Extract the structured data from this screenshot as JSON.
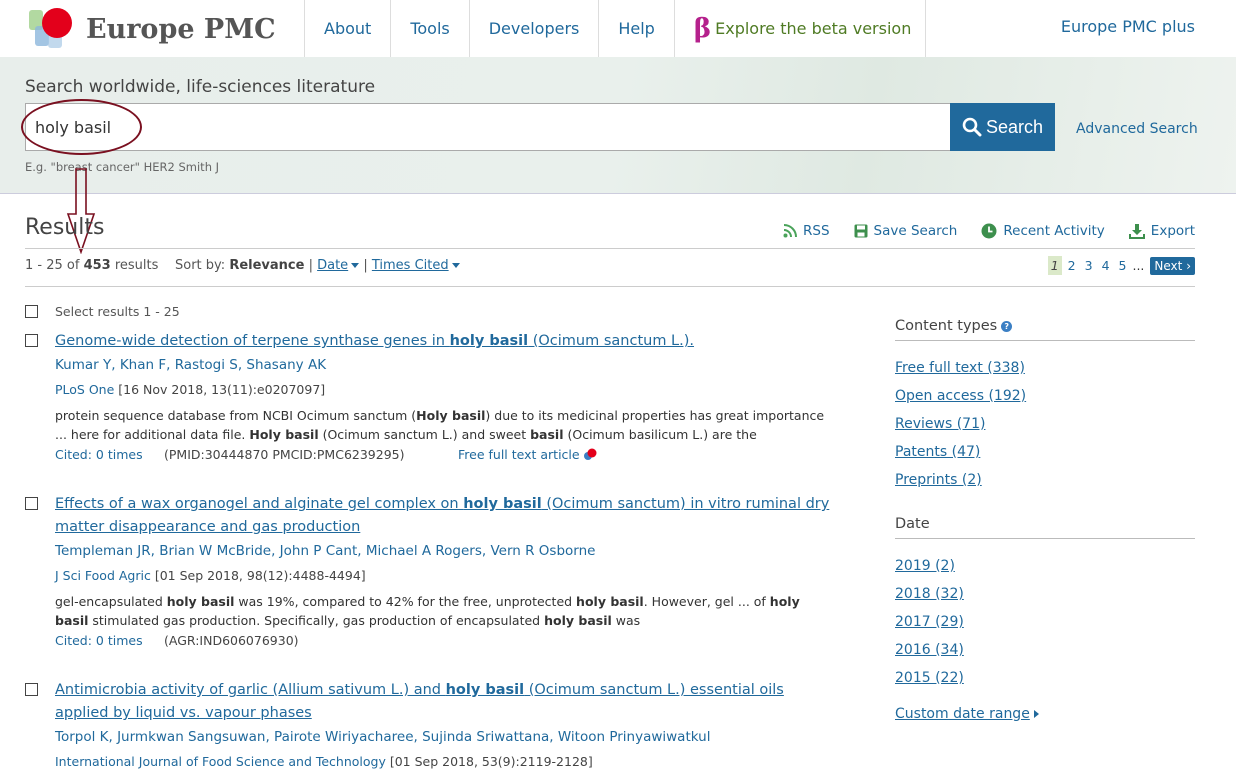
{
  "header": {
    "logo_text": "Europe PMC",
    "nav": [
      {
        "label": "About"
      },
      {
        "label": "Tools"
      },
      {
        "label": "Developers"
      },
      {
        "label": "Help"
      }
    ],
    "beta_glyph": "β",
    "beta_label": "Explore the beta version",
    "plus_label": "Europe PMC plus"
  },
  "search": {
    "label": "Search worldwide, life-sciences literature",
    "value": "holy basil",
    "button_label": "Search",
    "advanced_label": "Advanced Search",
    "example": "E.g. \"breast cancer\" HER2 Smith J"
  },
  "results": {
    "title": "Results",
    "range_prefix": "1 - 25 of ",
    "total": "453",
    "range_suffix": " results",
    "sort_label": "Sort by:",
    "sort_current": "Relevance",
    "sort_options": [
      "Date",
      "Times Cited"
    ],
    "select_all_label": "Select results 1 - 25"
  },
  "actions": {
    "rss": "RSS",
    "save": "Save Search",
    "recent": "Recent Activity",
    "export": "Export"
  },
  "pager": {
    "pages": [
      "1",
      "2",
      "3",
      "4",
      "5"
    ],
    "ellipsis": "...",
    "next_label": "Next"
  },
  "items": [
    {
      "title_before": "Genome-wide detection of terpene synthase genes in ",
      "title_bold": "holy basil",
      "title_after": " (Ocimum sanctum L.).",
      "authors": "Kumar Y, Khan F, Rastogi S, Shasany AK",
      "journal": "PLoS One",
      "citation": " [16 Nov 2018, 13(11):e0207097]",
      "snippet_a": "protein sequence database from NCBI Ocimum sanctum (",
      "snippet_b1": "Holy basil",
      "snippet_c": ") due to its medicinal properties has great importance ... here for additional data file. ",
      "snippet_b2": "Holy basil",
      "snippet_d": " (Ocimum sanctum L.) and sweet ",
      "snippet_b3": "basil",
      "snippet_e": " (Ocimum basilicum L.) are the",
      "cited": "Cited: 0 times",
      "ids": "(PMID:30444870 PMCID:PMC6239295)",
      "fulltext": "Free full text article"
    },
    {
      "title_before": "Effects of a wax organogel and alginate gel complex on ",
      "title_bold": "holy basil",
      "title_after": " (Ocimum sanctum) in vitro ruminal dry matter disappearance and gas production",
      "authors": "Templeman JR, Brian W McBride, John P Cant, Michael A Rogers, Vern R Osborne",
      "journal": "J Sci Food Agric",
      "citation": " [01 Sep 2018, 98(12):4488-4494]",
      "snippet_a": "gel-encapsulated ",
      "snippet_b1": "holy basil",
      "snippet_c": " was 19%, compared to 42% for the free, unprotected ",
      "snippet_b2": "holy basil",
      "snippet_d": ". However, gel ... of ",
      "snippet_b3": "holy basil",
      "snippet_e": " stimulated gas production. Specifically, gas production of encapsulated ",
      "snippet_b4": "holy basil",
      "snippet_f": " was",
      "cited": "Cited: 0 times",
      "ids": "(AGR:IND606076930)"
    },
    {
      "title_before": "Antimicrobia activity of garlic (Allium sativum L.) and ",
      "title_bold": "holy basil",
      "title_after": " (Ocimum sanctum L.) essential oils applied by liquid vs. vapour phases",
      "authors": "Torpol K, Jurmkwan Sangsuwan, Pairote Wiriyacharee, Sujinda Sriwattana, Witoon Prinyawiwatkul",
      "journal": "International Journal of Food Science and Technology",
      "citation": " [01 Sep 2018, 53(9):2119-2128]"
    }
  ],
  "sidebar": {
    "content_types_title": "Content types",
    "content_types": [
      {
        "label": "Free full text (338)"
      },
      {
        "label": "Open access (192)"
      },
      {
        "label": "Reviews (71)"
      },
      {
        "label": "Patents (47)"
      },
      {
        "label": "Preprints (2)"
      }
    ],
    "date_title": "Date",
    "dates": [
      {
        "label": "2019 (2)"
      },
      {
        "label": "2018 (32)"
      },
      {
        "label": "2017 (29)"
      },
      {
        "label": "2016 (34)"
      },
      {
        "label": "2015 (22)"
      }
    ],
    "custom_range": "Custom date range"
  },
  "colors": {
    "link": "#20699c",
    "beta_text": "#4f7b24",
    "beta_glyph": "#b5218c",
    "annotation": "#7a1020",
    "logo_red": "#e3001b"
  }
}
